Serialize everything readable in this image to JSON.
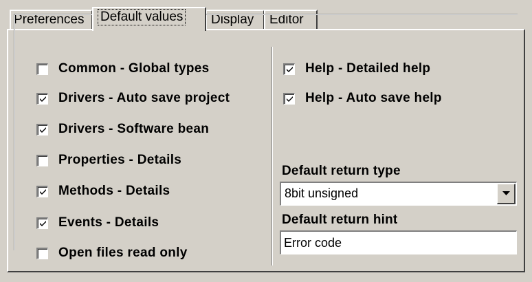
{
  "tabs": [
    {
      "label": "Preferences",
      "active": false
    },
    {
      "label": "Default values",
      "active": true
    },
    {
      "label": "Display",
      "active": false
    },
    {
      "label": "Editor",
      "active": false
    }
  ],
  "left_checkboxes": [
    {
      "label": "Common - Global types",
      "checked": false
    },
    {
      "label": "Drivers - Auto save project",
      "checked": true
    },
    {
      "label": "Drivers - Software bean",
      "checked": true
    },
    {
      "label": "Properties - Details",
      "checked": false
    },
    {
      "label": "Methods - Details",
      "checked": true
    },
    {
      "label": "Events - Details",
      "checked": true
    },
    {
      "label": "Open files read only",
      "checked": false
    }
  ],
  "right_checkboxes": [
    {
      "label": "Help - Detailed help",
      "checked": true
    },
    {
      "label": "Help - Auto save help",
      "checked": true
    }
  ],
  "return_type": {
    "label": "Default return type",
    "value": "8bit unsigned"
  },
  "return_hint": {
    "label": "Default return hint",
    "value": "Error code"
  }
}
